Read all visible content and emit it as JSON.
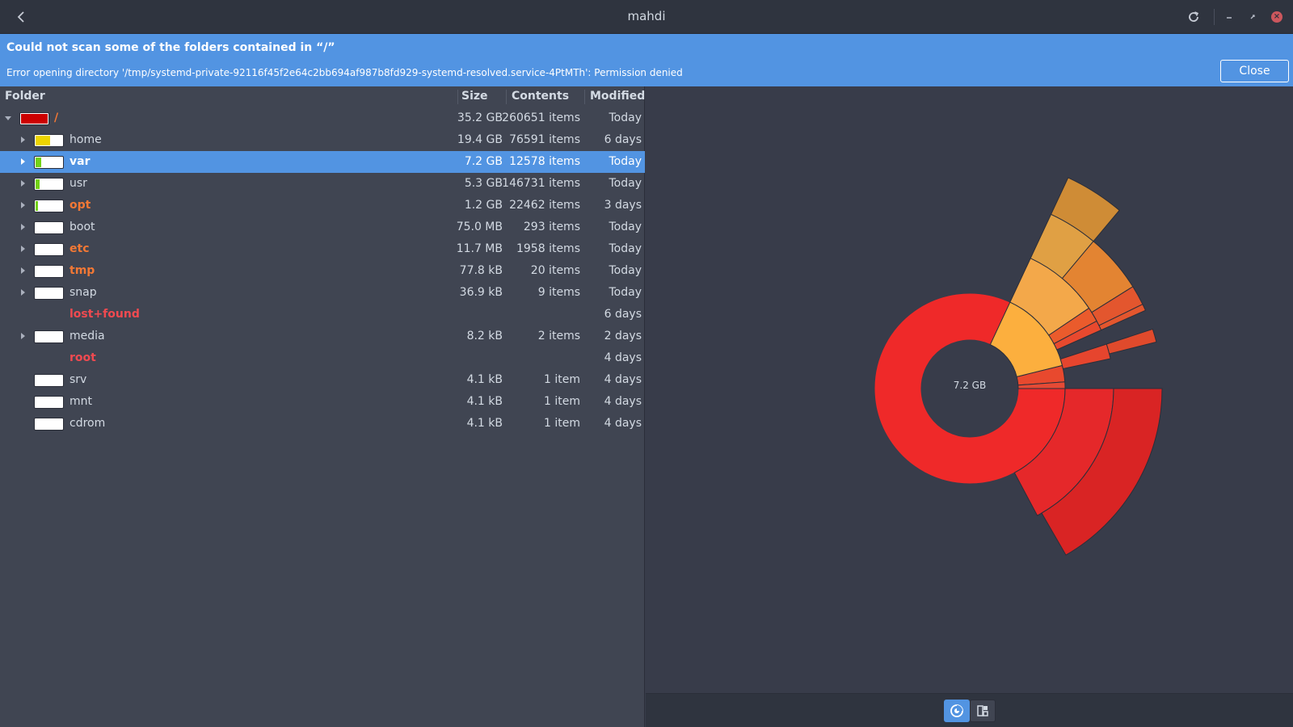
{
  "window": {
    "title": "mahdi",
    "back_icon": "chevron-left-icon",
    "reload_icon": "reload-icon",
    "minimize_icon": "minimize-icon",
    "maximize_icon": "maximize-icon",
    "close_icon": "close-icon"
  },
  "infobar": {
    "heading": "Could not scan some of the folders contained in “/”",
    "message": "Error opening directory '/tmp/systemd-private-92116f45f2e64c2bb694af987b8fd929-systemd-resolved.service-4PtMTh': Permission denied",
    "close_label": "Close",
    "background": "#5294e2"
  },
  "table": {
    "headers": {
      "folder": "Folder",
      "size": "Size",
      "contents": "Contents",
      "modified": "Modified"
    },
    "rows": [
      {
        "name": "/",
        "size": "35.2 GB",
        "contents": "260651 items",
        "modified": "Today",
        "usage": 1.0,
        "bar_color": "#cc0000",
        "name_color": "#f27835",
        "bold": true,
        "expander": "open",
        "depth": 0
      },
      {
        "name": "home",
        "size": "19.4 GB",
        "contents": "76591 items",
        "modified": "6 days",
        "usage": 0.55,
        "bar_color": "#edd400",
        "name_color": "",
        "bold": false,
        "expander": "closed",
        "depth": 1
      },
      {
        "name": "var",
        "size": "7.2 GB",
        "contents": "12578 items",
        "modified": "Today",
        "usage": 0.2,
        "bar_color": "#73d216",
        "name_color": "",
        "bold": true,
        "expander": "closed",
        "depth": 1,
        "selected": true
      },
      {
        "name": "usr",
        "size": "5.3 GB",
        "contents": "146731 items",
        "modified": "Today",
        "usage": 0.15,
        "bar_color": "#73d216",
        "name_color": "",
        "bold": false,
        "expander": "closed",
        "depth": 1
      },
      {
        "name": "opt",
        "size": "1.2 GB",
        "contents": "22462 items",
        "modified": "3 days",
        "usage": 0.03,
        "bar_color": "#73d216",
        "name_color": "#f27835",
        "bold": true,
        "expander": "closed",
        "depth": 1
      },
      {
        "name": "boot",
        "size": "75.0 MB",
        "contents": "293 items",
        "modified": "Today",
        "usage": 0,
        "bar_color": "#73d216",
        "name_color": "",
        "bold": false,
        "expander": "closed",
        "depth": 1
      },
      {
        "name": "etc",
        "size": "11.7 MB",
        "contents": "1958 items",
        "modified": "Today",
        "usage": 0,
        "bar_color": "#73d216",
        "name_color": "#f27835",
        "bold": true,
        "expander": "closed",
        "depth": 1
      },
      {
        "name": "tmp",
        "size": "77.8 kB",
        "contents": "20 items",
        "modified": "Today",
        "usage": 0,
        "bar_color": "#73d216",
        "name_color": "#f27835",
        "bold": true,
        "expander": "closed",
        "depth": 1
      },
      {
        "name": "snap",
        "size": "36.9 kB",
        "contents": "9 items",
        "modified": "Today",
        "usage": 0,
        "bar_color": "#73d216",
        "name_color": "",
        "bold": false,
        "expander": "closed",
        "depth": 1
      },
      {
        "name": "lost+found",
        "size": "",
        "contents": "",
        "modified": "6 days",
        "usage": null,
        "bar_color": "",
        "name_color": "#f04a50",
        "bold": true,
        "expander": "none",
        "depth": 1
      },
      {
        "name": "media",
        "size": "8.2 kB",
        "contents": "2 items",
        "modified": "2 days",
        "usage": 0,
        "bar_color": "#73d216",
        "name_color": "",
        "bold": false,
        "expander": "closed",
        "depth": 1
      },
      {
        "name": "root",
        "size": "",
        "contents": "",
        "modified": "4 days",
        "usage": null,
        "bar_color": "",
        "name_color": "#f04a50",
        "bold": true,
        "expander": "none",
        "depth": 1
      },
      {
        "name": "srv",
        "size": "4.1 kB",
        "contents": "1 item",
        "modified": "4 days",
        "usage": 0,
        "bar_color": "#73d216",
        "name_color": "",
        "bold": false,
        "expander": "none",
        "depth": 1
      },
      {
        "name": "mnt",
        "size": "4.1 kB",
        "contents": "1 item",
        "modified": "4 days",
        "usage": 0,
        "bar_color": "#73d216",
        "name_color": "",
        "bold": false,
        "expander": "none",
        "depth": 1
      },
      {
        "name": "cdrom",
        "size": "4.1 kB",
        "contents": "1 item",
        "modified": "4 days",
        "usage": 0,
        "bar_color": "#73d216",
        "name_color": "",
        "bold": false,
        "expander": "none",
        "depth": 1
      }
    ]
  },
  "chart": {
    "center_label": "7.2 GB",
    "rings_icon": "rings-chart-icon",
    "treemap_icon": "treemap-chart-icon"
  }
}
